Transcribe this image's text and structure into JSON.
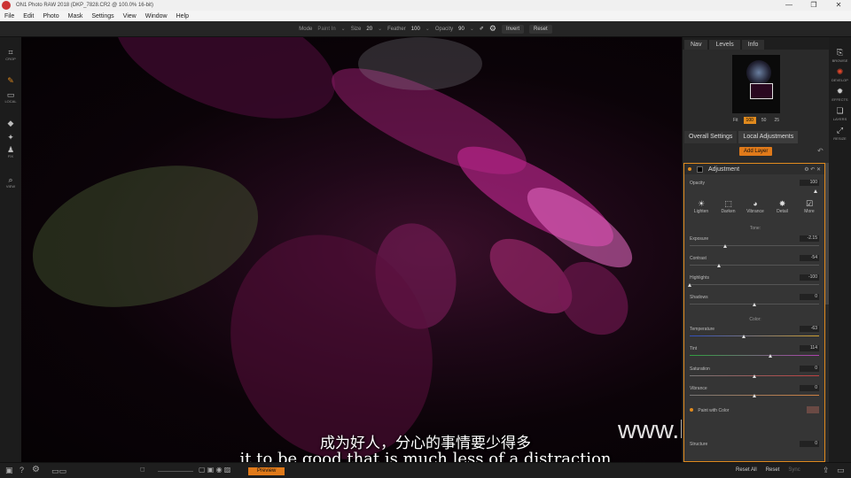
{
  "window": {
    "title": "ON1 Photo RAW 2018 (DKP_7828.CR2 @ 100.0% 16-bit)",
    "controls": [
      "—",
      "❐",
      "✕"
    ]
  },
  "menu": [
    "File",
    "Edit",
    "Photo",
    "Mask",
    "Settings",
    "View",
    "Window",
    "Help"
  ],
  "toolbar": {
    "mode_label": "Mode",
    "mode_value": "Paint In",
    "size_label": "Size",
    "size_value": "20",
    "feather_label": "Feather",
    "feather_value": "100",
    "opacity_label": "Opacity",
    "opacity_value": "90",
    "invert_label": "Invert",
    "reset_label": "Reset"
  },
  "left_tools": [
    {
      "icon": "crop-icon",
      "glyph": "⌗",
      "label": "CROP"
    },
    {
      "icon": "brush-icon",
      "glyph": "✎",
      "label": ""
    },
    {
      "icon": "local-icon",
      "glyph": "▭",
      "label": "LOCAL"
    },
    {
      "icon": "eraser-icon",
      "glyph": "◆",
      "label": ""
    },
    {
      "icon": "retouch-icon",
      "glyph": "✦",
      "label": ""
    },
    {
      "icon": "fix-icon",
      "glyph": "♟",
      "label": "FIX"
    },
    {
      "icon": "zoom-icon",
      "glyph": "⌕",
      "label": "VIEW"
    }
  ],
  "nav_tabs": [
    "Nav",
    "Levels",
    "Info"
  ],
  "zoom_options": [
    "Fit",
    "100",
    "50",
    "25"
  ],
  "zoom_active": "100",
  "panel_tabs": [
    "Overall Settings",
    "Local Adjustments"
  ],
  "add_layer_label": "Add Layer",
  "adjustment": {
    "title": "Adjustment",
    "opacity_label": "Opacity",
    "opacity_value": "100",
    "presets": [
      {
        "icon": "lighten-icon",
        "glyph": "☀",
        "label": "Lighten"
      },
      {
        "icon": "darken-icon",
        "glyph": "⬚",
        "label": "Darken"
      },
      {
        "icon": "vibrance-icon",
        "glyph": "◕",
        "label": "Vibrance"
      },
      {
        "icon": "detail-icon",
        "glyph": "✸",
        "label": "Detail"
      },
      {
        "icon": "more-icon",
        "glyph": "☑",
        "label": "More"
      }
    ],
    "tone_label": "Tone:",
    "color_label": "Color:",
    "sliders": [
      {
        "label": "Exposure",
        "value": "-2.15",
        "level": 0.28
      },
      {
        "label": "Contrast",
        "value": "-54",
        "level": 0.23
      },
      {
        "label": "Highlights",
        "value": "-100",
        "level": 0.0
      },
      {
        "label": "Shadows",
        "value": "0",
        "level": 0.5
      },
      {
        "label": "Temperature",
        "value": "-63",
        "level": 0.42
      },
      {
        "label": "Tint",
        "value": "114",
        "level": 0.63
      },
      {
        "label": "Saturation",
        "value": "0",
        "level": 0.5
      },
      {
        "label": "Vibrance",
        "value": "0",
        "level": 0.5
      }
    ],
    "paint_label": "Paint with Color",
    "structure_label": "Structure",
    "structure_value": "0"
  },
  "right_modules": [
    {
      "icon": "browse-icon",
      "glyph": "⎘",
      "label": "BROWSE"
    },
    {
      "icon": "develop-icon",
      "glyph": "✺",
      "label": "DEVELOP"
    },
    {
      "icon": "effects-icon",
      "glyph": "✹",
      "label": "EFFECTS"
    },
    {
      "icon": "layers-icon",
      "glyph": "❏",
      "label": "LAYERS"
    },
    {
      "icon": "resize-icon",
      "glyph": "⤢",
      "label": "RESIZE"
    }
  ],
  "statusbar": {
    "preview_label": "Preview",
    "reset_all": "Reset All",
    "reset": "Reset",
    "sync": "Sync"
  },
  "subtitles": {
    "cn": "成为好人，分心的事情要少得多",
    "en": "it to be good that is much less of a distraction"
  },
  "watermark": "www.hunls.com",
  "colors": {
    "accent": "#e08a1e"
  }
}
